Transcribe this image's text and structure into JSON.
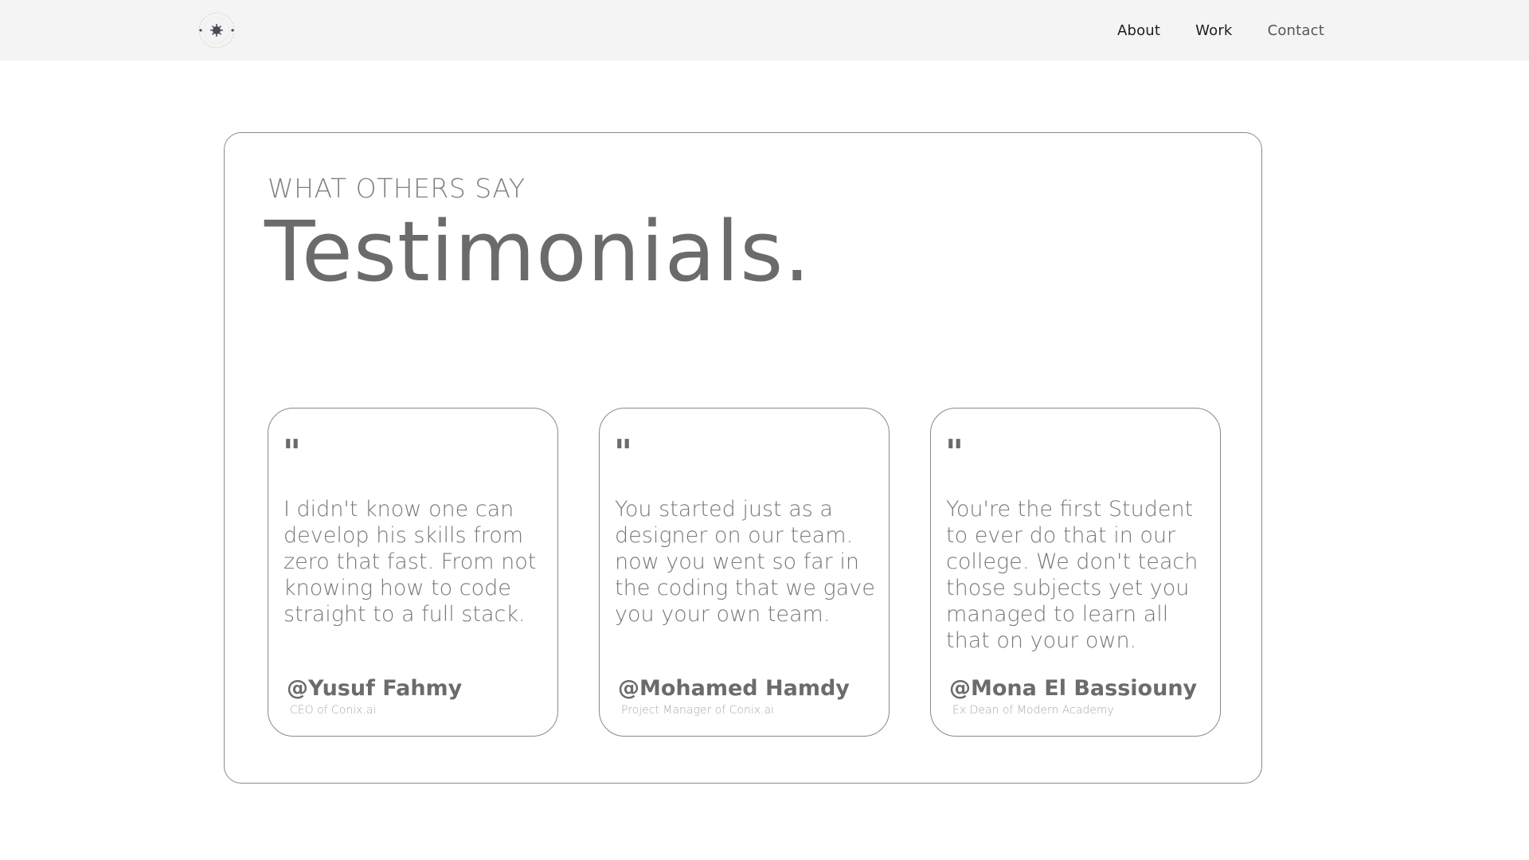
{
  "nav": {
    "logo_icon": "circular-badge-logo-icon",
    "links": [
      "About",
      "Work",
      "Contact"
    ]
  },
  "section": {
    "eyebrow": "WHAT OTHERS SAY",
    "title": "Testimonials."
  },
  "testimonials": [
    {
      "quote_mark": "\"",
      "text": "I didn't know one can develop his skills from zero that fast. From not knowing how to code straight to a full stack.",
      "author": "@Yusuf Fahmy",
      "role": "CEO of Conix.ai"
    },
    {
      "quote_mark": "\"",
      "text": "You started just as a designer on our team. now you went so far in the coding that we gave you your own team.",
      "author": "@Mohamed Hamdy",
      "role": "Project Manager of Conix.ai"
    },
    {
      "quote_mark": "\"",
      "text": "You're the first Student to ever do that in our college. We don't teach those subjects yet you managed to learn all that on your own.",
      "author": "@Mona El Bassiouny",
      "role": "Ex Dean of Modern Academy"
    }
  ]
}
